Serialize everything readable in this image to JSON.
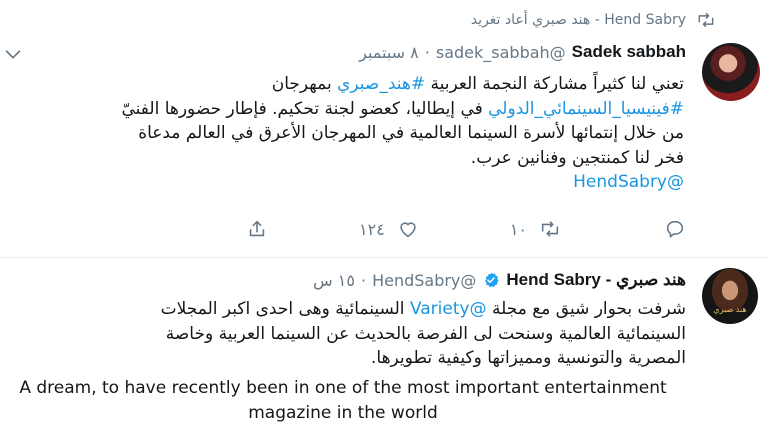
{
  "colors": {
    "link": "#1b95e0",
    "muted": "#657786",
    "text": "#14171a",
    "verified": "#1da1f2"
  },
  "retweet_header": {
    "text": "Hend Sabry - هند صبري أعاد تغريد",
    "icon": "retweet-icon"
  },
  "tweet1": {
    "name": "Sadek sabbah",
    "handle": "@sadek_sabbah",
    "dot": "·",
    "time": "٨ سبتمبر",
    "lines": [
      [
        "تعني لنا كثيراً مشاركة النجمة العربية ",
        "#هند_صبري",
        " بمهرجان"
      ],
      [
        "#فينيسيا_السينمائي_الدولي",
        " في إيطاليا، كعضو لجنة تحكيم. فإطار حضورها الفنيّ"
      ],
      [
        "من خلال إنتمائها لأسرة السينما العالمية في المهرجان الأعرق في العالم مدعاة"
      ],
      [
        "فخر لنا كمنتجين وفنانين عرب."
      ],
      [
        "@HendSabry"
      ]
    ],
    "actions": {
      "reply_count": "",
      "retweet_count": "١٠",
      "like_count": "١٢٤"
    }
  },
  "tweet2": {
    "name": "هند صبري - Hend Sabry",
    "handle": "@HendSabry",
    "dot": "·",
    "time": "١٥ س",
    "avatar_caption": "هند صبري",
    "arabic_lines": [
      [
        "شرفت بحوار شيق مع مجلة ",
        "@Variety",
        "  السينمائية وهى احدى اكبر المجلات"
      ],
      [
        "السينمائية العالمية وسنحت لى الفرصة بالحديث عن السينما العربية وخاصة"
      ],
      [
        "المصرية والتونسية ومميزاتها وكيفية تطويرها."
      ]
    ],
    "english_lines": [
      "A dream, to have recently been in one of the most important entertainment",
      "magazine in the world"
    ]
  }
}
